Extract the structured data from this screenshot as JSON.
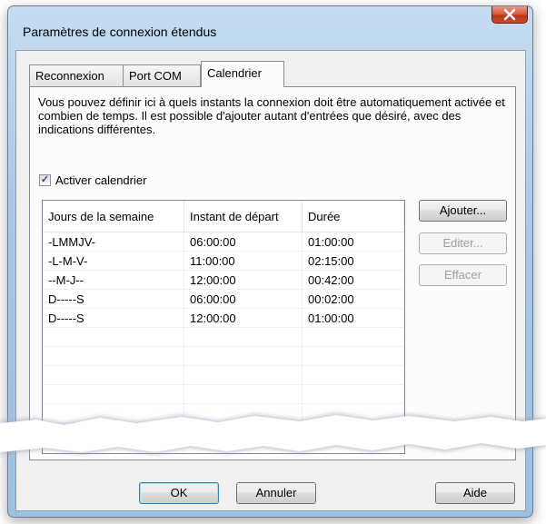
{
  "window": {
    "title": "Paramètres de connexion étendus",
    "close_label": "X"
  },
  "tabs": [
    {
      "label": "Reconnexion",
      "active": false
    },
    {
      "label": "Port COM",
      "active": false
    },
    {
      "label": "Calendrier",
      "active": true
    }
  ],
  "panel": {
    "description": "Vous pouvez définir ici à quels instants la connexion doit être automatiquement activée et combien de temps. Il est possible d'ajouter autant d'entrées que désiré, avec des indications différentes.",
    "enable_checkbox": {
      "label": "Activer calendrier",
      "checked": true
    }
  },
  "schedule": {
    "columns": [
      "Jours de la semaine",
      "Instant de départ",
      "Durée"
    ],
    "rows": [
      [
        "-LMMJV-",
        "06:00:00",
        "01:00:00"
      ],
      [
        "-L-M-V-",
        "11:00:00",
        "02:15:00"
      ],
      [
        "--M-J--",
        "12:00:00",
        "00:42:00"
      ],
      [
        "D-----S",
        "06:00:00",
        "00:02:00"
      ],
      [
        "D-----S",
        "12:00:00",
        "01:00:00"
      ]
    ]
  },
  "side_buttons": {
    "add": "Ajouter...",
    "edit": "Editer...",
    "delete": "Effacer"
  },
  "footer_buttons": {
    "ok": "OK",
    "cancel": "Annuler",
    "help": "Aide"
  },
  "colors": {
    "frame": "#a9c8e6",
    "close": "#c74e2f",
    "client": "#f0f0f0"
  }
}
